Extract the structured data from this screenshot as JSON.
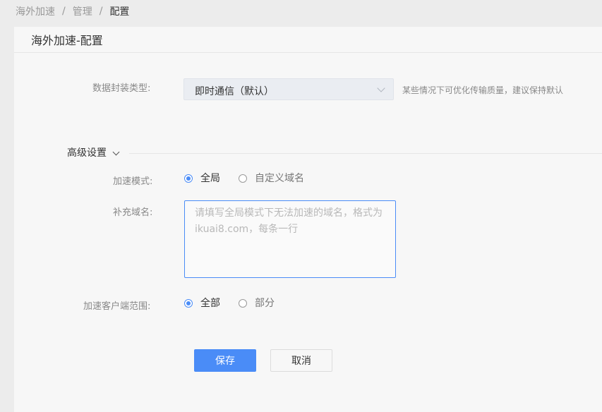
{
  "breadcrumb": {
    "items": [
      "海外加速",
      "管理",
      "配置"
    ],
    "separator": "/"
  },
  "card": {
    "title": "海外加速-配置"
  },
  "encapsulation": {
    "label": "数据封装类型:",
    "selected": "即时通信（默认）",
    "hint": "某些情况下可优化传输质量，建议保持默认"
  },
  "advanced": {
    "label": "高级设置"
  },
  "accel_mode": {
    "label": "加速模式:",
    "options": [
      "全局",
      "自定义域名"
    ],
    "selected_index": 0
  },
  "extra_domains": {
    "label": "补充域名:",
    "placeholder": "请填写全局模式下无法加速的域名，格式为 ikuai8.com，每条一行",
    "value": ""
  },
  "client_scope": {
    "label": "加速客户端范围:",
    "options": [
      "全部",
      "部分"
    ],
    "selected_index": 0
  },
  "actions": {
    "save": "保存",
    "cancel": "取消"
  },
  "colors": {
    "accent": "#4a8cf7"
  }
}
